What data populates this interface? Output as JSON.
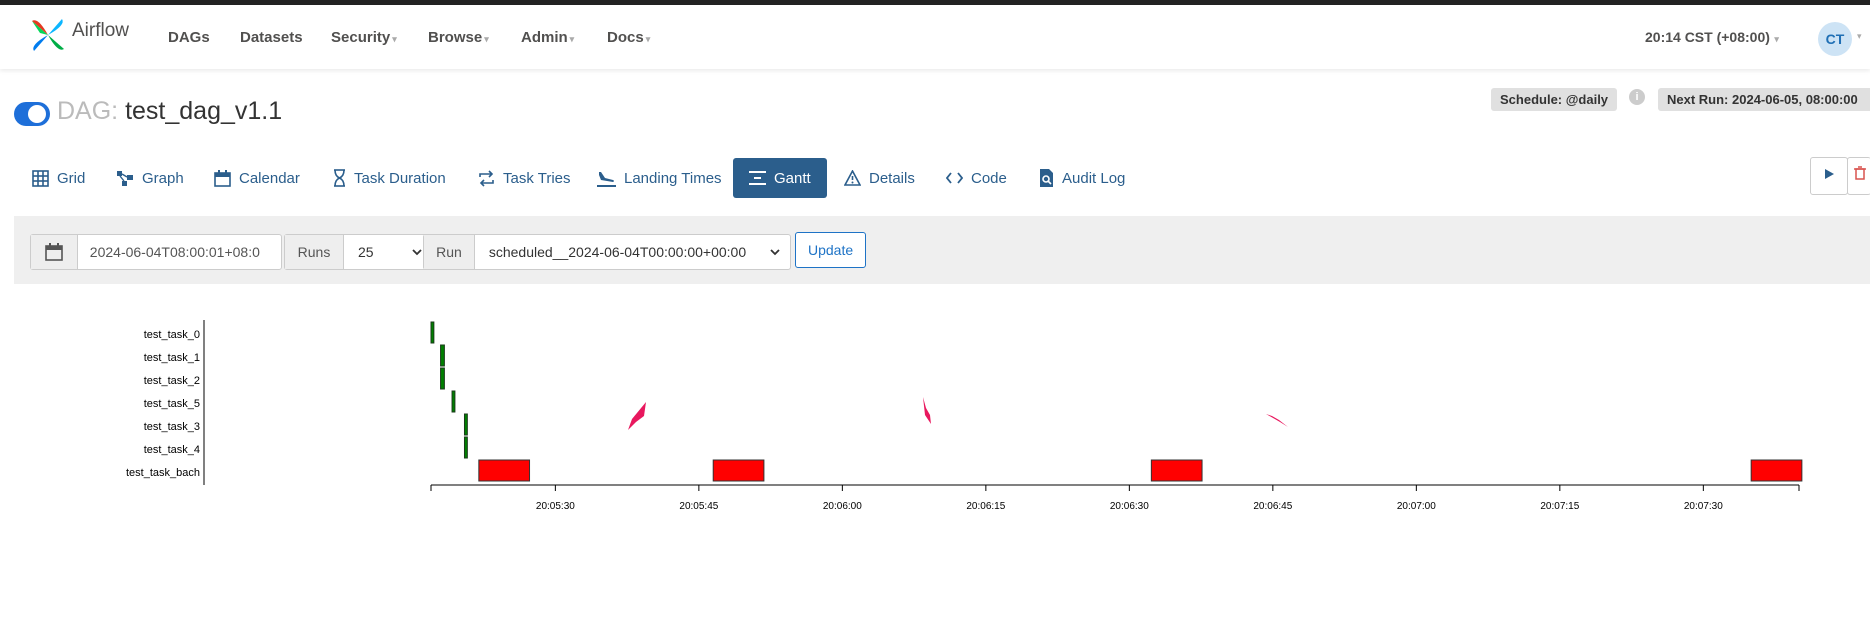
{
  "app": {
    "brand": "Airflow",
    "nav": [
      {
        "label": "DAGs",
        "caret": false
      },
      {
        "label": "Datasets",
        "caret": false
      },
      {
        "label": "Security",
        "caret": true
      },
      {
        "label": "Browse",
        "caret": true
      },
      {
        "label": "Admin",
        "caret": true
      },
      {
        "label": "Docs",
        "caret": true
      }
    ],
    "clock": "20:14 CST (+08:00)",
    "avatar": "CT"
  },
  "dag": {
    "prefix": "DAG:",
    "name": "test_dag_v1.1",
    "schedule": "Schedule: @daily",
    "next_run": "Next Run: 2024-06-05, 08:00:00"
  },
  "tabs": [
    {
      "label": "Grid",
      "icon": "grid-icon"
    },
    {
      "label": "Graph",
      "icon": "graph-icon"
    },
    {
      "label": "Calendar",
      "icon": "calendar-icon"
    },
    {
      "label": "Task Duration",
      "icon": "hourglass-icon"
    },
    {
      "label": "Task Tries",
      "icon": "retry-icon"
    },
    {
      "label": "Landing Times",
      "icon": "landing-icon"
    },
    {
      "label": "Gantt",
      "icon": "gantt-icon",
      "active": true
    },
    {
      "label": "Details",
      "icon": "warning-icon"
    },
    {
      "label": "Code",
      "icon": "code-icon"
    },
    {
      "label": "Audit Log",
      "icon": "audit-icon"
    }
  ],
  "filters": {
    "date_value": "2024-06-04T08:00:01+08:0",
    "runs_label": "Runs",
    "runs_value": "25",
    "run_label": "Run",
    "run_value": "scheduled__2024-06-04T00:00:00+00:00",
    "update_label": "Update"
  },
  "chart_data": {
    "type": "gantt",
    "tasks": [
      "test_task_0",
      "test_task_1",
      "test_task_2",
      "test_task_5",
      "test_task_3",
      "test_task_4",
      "test_task_bach"
    ],
    "x_ticks": [
      "20:05:30",
      "20:05:45",
      "20:06:00",
      "20:06:15",
      "20:06:30",
      "20:06:45",
      "20:07:00",
      "20:07:15",
      "20:07:30"
    ],
    "x_range": [
      "20:05:17",
      "20:07:40"
    ],
    "bars": [
      {
        "task": "test_task_0",
        "start": "20:05:17.0",
        "end": "20:05:17.3",
        "state": "success"
      },
      {
        "task": "test_task_1",
        "start": "20:05:18.0",
        "end": "20:05:18.4",
        "state": "success"
      },
      {
        "task": "test_task_2",
        "start": "20:05:18.0",
        "end": "20:05:18.4",
        "state": "success"
      },
      {
        "task": "test_task_5",
        "start": "20:05:19.2",
        "end": "20:05:19.5",
        "state": "success"
      },
      {
        "task": "test_task_3",
        "start": "20:05:20.5",
        "end": "20:05:20.8",
        "state": "success"
      },
      {
        "task": "test_task_4",
        "start": "20:05:20.5",
        "end": "20:05:20.8",
        "state": "success"
      },
      {
        "task": "test_task_bach",
        "start": "20:05:22",
        "end": "20:05:27.3",
        "state": "failed"
      },
      {
        "task": "test_task_bach",
        "start": "20:05:46.5",
        "end": "20:05:51.8",
        "state": "failed"
      },
      {
        "task": "test_task_bach",
        "start": "20:06:32.3",
        "end": "20:06:37.6",
        "state": "failed"
      },
      {
        "task": "test_task_bach",
        "start": "20:07:35",
        "end": "20:07:40.3",
        "state": "failed"
      }
    ],
    "colors": {
      "success": "#008000",
      "success_stroke": "#1a3a1a",
      "failed": "#ff0000",
      "failed_stroke": "#333333"
    }
  }
}
